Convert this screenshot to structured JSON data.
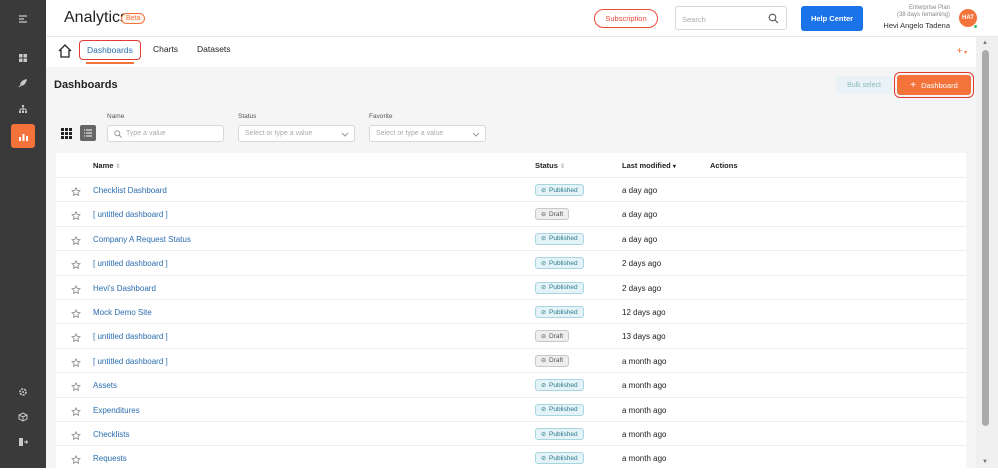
{
  "app": {
    "title": "Analytics",
    "badge": "Beta"
  },
  "header": {
    "subscription_label": "Subscription",
    "search_placeholder": "Search",
    "help_label": "Help Center",
    "plan_name": "Enterprise Plan",
    "plan_remaining": "(38 days remaining)",
    "user_name": "Hevi Angelo Tadena",
    "avatar_initials": "HAT"
  },
  "tabs": [
    "Dashboards",
    "Charts",
    "Datasets"
  ],
  "page": {
    "title": "Dashboards",
    "bulk_select_label": "Bulk select",
    "new_dashboard_label": "Dashboard"
  },
  "filters": {
    "name": {
      "label": "Name",
      "placeholder": "Type a value"
    },
    "status": {
      "label": "Status",
      "placeholder": "Select or type a value"
    },
    "favorite": {
      "label": "Favorite",
      "placeholder": "Select or type a value"
    }
  },
  "table": {
    "columns": {
      "name": "Name",
      "status": "Status",
      "modified": "Last modified",
      "actions": "Actions"
    },
    "rows": [
      {
        "name": "Checklist Dashboard",
        "status": "Published",
        "modified": "a day ago"
      },
      {
        "name": "[ untitled dashboard ]",
        "status": "Draft",
        "modified": "a day ago"
      },
      {
        "name": "Company A Request Status",
        "status": "Published",
        "modified": "a day ago"
      },
      {
        "name": "[ untitled dashboard ]",
        "status": "Published",
        "modified": "2 days ago"
      },
      {
        "name": "Hevi's Dashboard",
        "status": "Published",
        "modified": "2 days ago"
      },
      {
        "name": "Mock Demo Site",
        "status": "Published",
        "modified": "12 days ago"
      },
      {
        "name": "[ untitled dashboard ]",
        "status": "Draft",
        "modified": "13 days ago"
      },
      {
        "name": "[ untitled dashboard ]",
        "status": "Draft",
        "modified": "a month ago"
      },
      {
        "name": "Assets",
        "status": "Published",
        "modified": "a month ago"
      },
      {
        "name": "Expenditures",
        "status": "Published",
        "modified": "a month ago"
      },
      {
        "name": "Checklists",
        "status": "Published",
        "modified": "a month ago"
      },
      {
        "name": "Requests",
        "status": "Published",
        "modified": "a month ago"
      }
    ]
  },
  "colors": {
    "accent": "#f4733b",
    "link": "#2a6db0",
    "primary": "#1a73e8",
    "sidebar": "#3a3a3a"
  }
}
